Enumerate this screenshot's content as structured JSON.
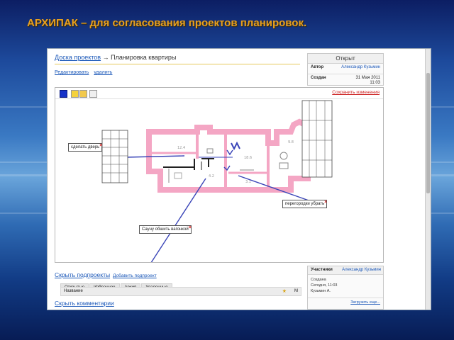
{
  "slide": {
    "title": "АРХИПАК – для согласования проектов планировок."
  },
  "breadcrumb": {
    "root": "Доска проектов",
    "separator": " → ",
    "current": "Планировка квартиры"
  },
  "actions": {
    "edit": "Редактировать",
    "delete": "удалить"
  },
  "info": {
    "status": "Открыт",
    "author_label": "Автор",
    "author_value": "Александр Кузьмин",
    "created_label": "Создан",
    "created_date": "31 Мая 2011",
    "created_time": "11:03"
  },
  "editor": {
    "save_changes": "Сохранить изменения",
    "tools": [
      "color-blue-icon",
      "pencil-icon",
      "brush-icon",
      "line-icon"
    ],
    "accent_color": "#1632c8",
    "annotation_color": "#3a45b8",
    "wall_color": "#f4a6c4",
    "callouts": {
      "door": "сделать дверь",
      "partitions": "перегородки убрать",
      "sauna": "Сауну обшить вагонкой"
    }
  },
  "subprojects": {
    "hide": "Скрыть подпроекты",
    "add": "Добавить подпроект",
    "tabs": [
      "Открытые",
      "Избранное",
      "Архив",
      "Удаленные"
    ],
    "list_header": {
      "name": "Название",
      "m": "М"
    }
  },
  "comments": {
    "hide": "Скрыть комментарии"
  },
  "participants": {
    "label": "Участники",
    "user": "Александр Кузьмин",
    "created": "Создана",
    "today": "Сегодня, 11:03",
    "initials": "Кузьмин А.",
    "load_more": "Загрузить еще..."
  }
}
